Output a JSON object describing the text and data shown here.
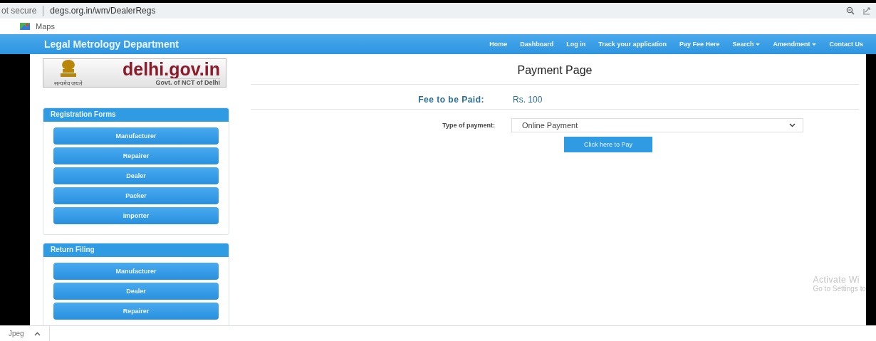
{
  "browser": {
    "security_label": "ot secure",
    "url": "degs.org.in/wm/DealerRegs",
    "bookmarks": [
      {
        "label": "Maps"
      }
    ]
  },
  "navbar": {
    "brand": "Legal Metrology Department",
    "items": [
      {
        "label": "Home",
        "dropdown": false
      },
      {
        "label": "Dashboard",
        "dropdown": false
      },
      {
        "label": "Log in",
        "dropdown": false
      },
      {
        "label": "Track your application",
        "dropdown": false
      },
      {
        "label": "Pay Fee Here",
        "dropdown": false
      },
      {
        "label": "Search",
        "dropdown": true
      },
      {
        "label": "Amendment",
        "dropdown": true
      },
      {
        "label": "Contact Us",
        "dropdown": false
      }
    ]
  },
  "logo": {
    "title": "delhi.gov.in",
    "subtitle": "Govt. of NCT of Delhi",
    "emblem_caption": "सत्यमेव जयते"
  },
  "sidebar": {
    "panels": [
      {
        "title": "Registration Forms",
        "buttons": [
          "Manufacturer",
          "Repairer",
          "Dealer",
          "Packer",
          "Importer"
        ]
      },
      {
        "title": "Return Filing",
        "buttons": [
          "Manufacturer",
          "Dealer",
          "Repairer"
        ]
      }
    ]
  },
  "main": {
    "title": "Payment Page",
    "fee_label": "Fee to be Paid:",
    "fee_value": "Rs. 100",
    "payment_type_label": "Type of payment:",
    "payment_type_value": "Online Payment",
    "pay_button": "Click here to Pay"
  },
  "download_bar": {
    "file": "Jpeg"
  },
  "os_notice": {
    "line_1": "Activate Wi",
    "line_2": "Go to Settings to"
  }
}
